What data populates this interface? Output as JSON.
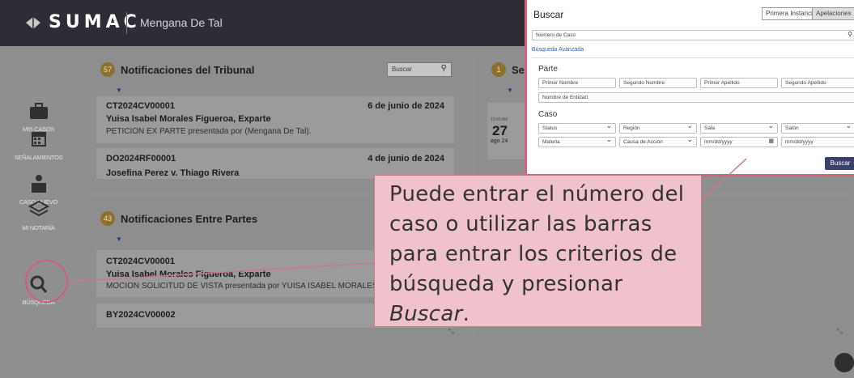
{
  "header": {
    "brand": "SUMAC",
    "user_name": "Mengana De Tal"
  },
  "sidebar": {
    "items": [
      {
        "label": "MIS CASOS",
        "icon": "briefcase-icon"
      },
      {
        "label": "SEÑALAMIENTOS",
        "icon": "calendar-icon"
      },
      {
        "label": "CASO NUEVO",
        "icon": "new-case-icon"
      },
      {
        "label": "MI NOTARÍA",
        "icon": "layers-icon"
      },
      {
        "label": "BÚSQUEDA",
        "icon": "search-icon"
      }
    ]
  },
  "tribunal_card": {
    "count": "57",
    "title": "Notificaciones del Tribunal",
    "search_placeholder": "Buscar",
    "items": [
      {
        "case": "CT2024CV00001",
        "date": "6 de junio de 2024",
        "party": "Yuisa Isabel Morales Figueroa, Exparte",
        "desc": "PETICIÓN EX PARTE presentada por (Mengana De Tal)."
      },
      {
        "case": "DO2024RF00001",
        "date": "4 de junio de 2024",
        "party": "Josefina Perez v. Thiago Rivera",
        "desc": ""
      }
    ]
  },
  "senalamientos_card": {
    "count": "1",
    "title": "Señ",
    "event_time": "10:00 AM",
    "event_day": "27",
    "event_month": "ago 24"
  },
  "partes_card": {
    "count": "43",
    "title": "Notificaciones Entre Partes",
    "items": [
      {
        "case": "CT2024CV00001",
        "party": "Yuisa Isabel Morales Figueroa, Exparte",
        "desc": "MOCIÓN SOLICITUD DE VISTA presentada por YUISA ISABEL MORALES FIGUERO"
      },
      {
        "case": "BY2024CV00002",
        "party": "",
        "desc": ""
      }
    ]
  },
  "search_panel": {
    "title": "Buscar",
    "tab_first": "Primera Instancia",
    "tab_appeals": "Apelaciones",
    "case_number_placeholder": "Número de Caso",
    "advanced_link": "Búsqueda Avanzada",
    "parte_heading": "Parte",
    "first_name": "Primer Nombre",
    "second_name": "Segundo Nombre",
    "first_surname": "Primer Apellido",
    "second_surname": "Segundo Apellido",
    "entity_name": "Nombre de Entidad",
    "caso_heading": "Caso",
    "status": "Status",
    "region": "Región",
    "sala": "Sala",
    "salon": "Salón",
    "materia": "Materia",
    "causa": "Causa de Acción",
    "date_from": "mm/dd/yyyy",
    "date_to": "mm/dd/yyyy",
    "submit": "Buscar"
  },
  "callout": {
    "line1": "Puede entrar el número del caso o utilizar las barras para entrar los criterios de búsqueda y presionar ",
    "emphasis": "Buscar",
    "end": "."
  }
}
